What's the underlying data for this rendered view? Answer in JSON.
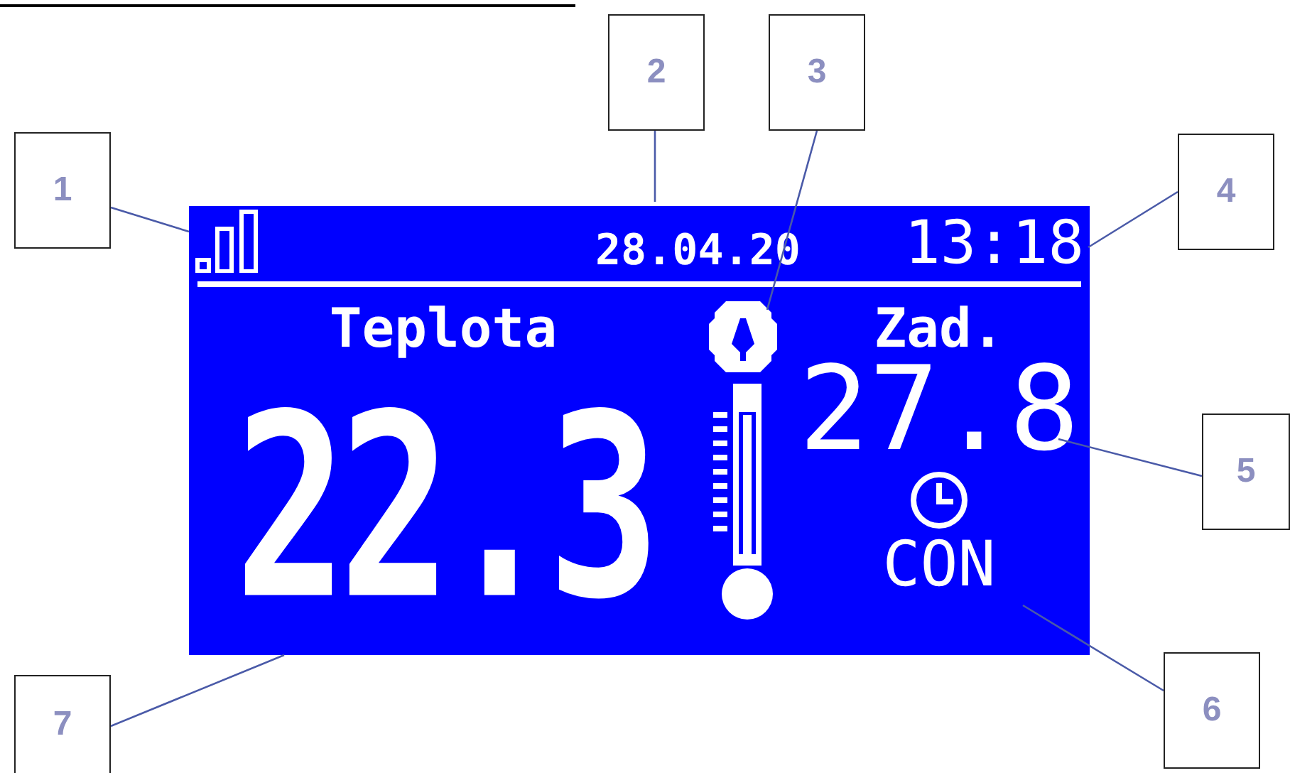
{
  "display": {
    "date": "28.04.20",
    "time": "13:18",
    "current_label": "Teplota",
    "current_temperature": "22.3",
    "setpoint_label": "Zad.",
    "setpoint_temperature": "27.8",
    "mode": "CON"
  },
  "callouts": [
    {
      "label": "1"
    },
    {
      "label": "2"
    },
    {
      "label": "3"
    },
    {
      "label": "4"
    },
    {
      "label": "5"
    },
    {
      "label": "6"
    },
    {
      "label": "7"
    }
  ]
}
